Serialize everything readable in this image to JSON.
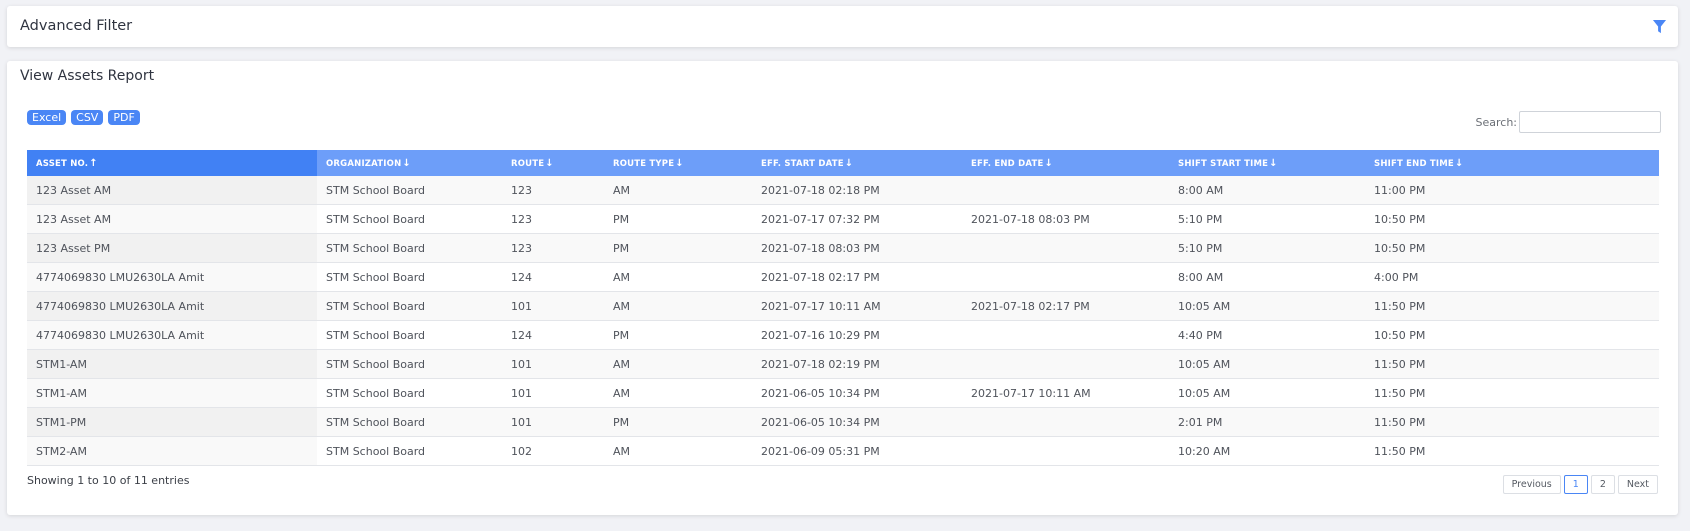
{
  "filter": {
    "title": "Advanced Filter",
    "icon": "filter-icon"
  },
  "report": {
    "title": "View Assets Report",
    "export_buttons": [
      "Excel",
      "CSV",
      "PDF"
    ],
    "search": {
      "label": "Search:",
      "value": "",
      "placeholder": ""
    },
    "columns": [
      {
        "label": "ASSET NO.",
        "arrow": "🠕",
        "sorted": true
      },
      {
        "label": "ORGANIZATION",
        "arrow": "🠗",
        "sorted": false
      },
      {
        "label": "ROUTE",
        "arrow": "🠗",
        "sorted": false
      },
      {
        "label": "ROUTE TYPE",
        "arrow": "🠗",
        "sorted": false
      },
      {
        "label": "EFF. START DATE",
        "arrow": "🠗",
        "sorted": false
      },
      {
        "label": "EFF. END DATE",
        "arrow": "🠗",
        "sorted": false
      },
      {
        "label": "SHIFT START TIME",
        "arrow": "🠗",
        "sorted": false
      },
      {
        "label": "SHIFT END TIME",
        "arrow": "🠗",
        "sorted": false
      }
    ],
    "rows": [
      [
        "123 Asset AM",
        "STM School Board",
        "123",
        "AM",
        "2021-07-18 02:18 PM",
        "",
        "8:00 AM",
        "11:00 PM"
      ],
      [
        "123 Asset AM",
        "STM School Board",
        "123",
        "PM",
        "2021-07-17 07:32 PM",
        "2021-07-18 08:03 PM",
        "5:10 PM",
        "10:50 PM"
      ],
      [
        "123 Asset PM",
        "STM School Board",
        "123",
        "PM",
        "2021-07-18 08:03 PM",
        "",
        "5:10 PM",
        "10:50 PM"
      ],
      [
        "4774069830 LMU2630LA Amit",
        "STM School Board",
        "124",
        "AM",
        "2021-07-18 02:17 PM",
        "",
        "8:00 AM",
        "4:00 PM"
      ],
      [
        "4774069830 LMU2630LA Amit",
        "STM School Board",
        "101",
        "AM",
        "2021-07-17 10:11 AM",
        "2021-07-18 02:17 PM",
        "10:05 AM",
        "11:50 PM"
      ],
      [
        "4774069830 LMU2630LA Amit",
        "STM School Board",
        "124",
        "PM",
        "2021-07-16 10:29 PM",
        "",
        "4:40 PM",
        "10:50 PM"
      ],
      [
        "STM1-AM",
        "STM School Board",
        "101",
        "AM",
        "2021-07-18 02:19 PM",
        "",
        "10:05 AM",
        "11:50 PM"
      ],
      [
        "STM1-AM",
        "STM School Board",
        "101",
        "AM",
        "2021-06-05 10:34 PM",
        "2021-07-17 10:11 AM",
        "10:05 AM",
        "11:50 PM"
      ],
      [
        "STM1-PM",
        "STM School Board",
        "101",
        "PM",
        "2021-06-05 10:34 PM",
        "",
        "2:01 PM",
        "11:50 PM"
      ],
      [
        "STM2-AM",
        "STM School Board",
        "102",
        "AM",
        "2021-06-09 05:31 PM",
        "",
        "10:20 AM",
        "11:50 PM"
      ]
    ],
    "info": "Showing 1 to 10 of 11 entries",
    "pagination": {
      "previous": "Previous",
      "pages": [
        "1",
        "2"
      ],
      "active": "1",
      "next": "Next"
    }
  },
  "colors": {
    "accent": "#4a86f5",
    "header": "#6d9ef9",
    "header_sorted": "#4181f4"
  }
}
